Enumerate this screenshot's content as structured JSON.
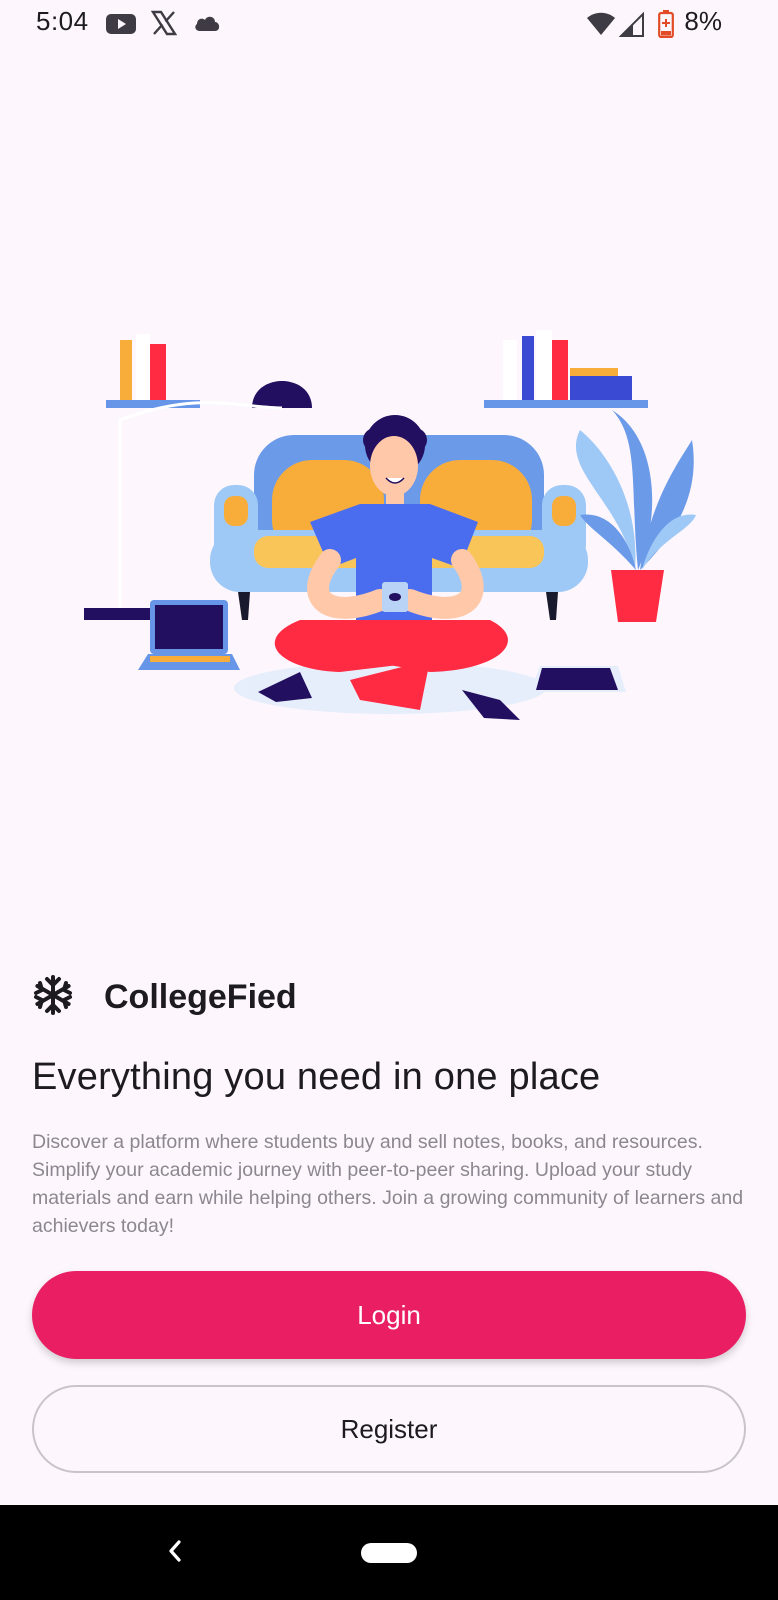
{
  "status_bar": {
    "time": "5:04",
    "battery_percent": "8%",
    "icons": [
      "youtube-icon",
      "x-icon",
      "cloud-icon",
      "wifi-icon",
      "signal-icon",
      "battery-icon"
    ]
  },
  "brand": {
    "icon": "snowflake-icon",
    "name": "CollegeFied"
  },
  "headline": "Everything you need in one place",
  "description": "Discover a platform where students buy and sell notes, books, and resources. Simplify your academic journey with peer-to-peer sharing. Upload your study materials and earn while helping others. Join a growing community of learners and achievers today!",
  "buttons": {
    "login": "Login",
    "register": "Register"
  },
  "colors": {
    "accent": "#e91e63",
    "background": "#fdf7fd"
  },
  "nav_bar": {
    "icons": [
      "back-icon",
      "home-pill"
    ]
  }
}
